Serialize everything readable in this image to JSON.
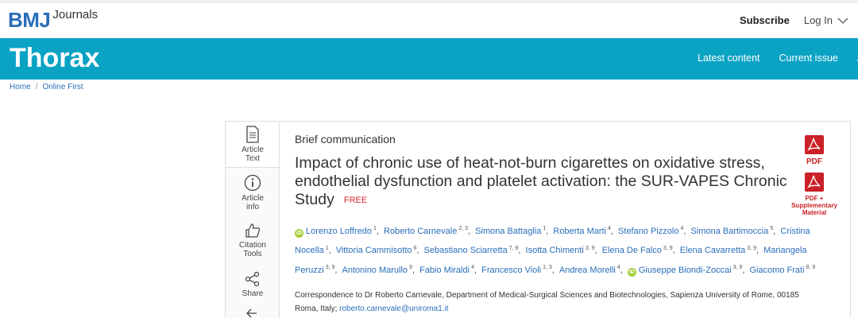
{
  "header": {
    "brand": "BMJ",
    "brand_suffix": "Journals",
    "subscribe": "Subscribe",
    "login": "Log In"
  },
  "banner": {
    "journal": "Thorax",
    "nav": [
      "Latest content",
      "Current issue",
      "A"
    ]
  },
  "breadcrumb": [
    "Home",
    "Online First"
  ],
  "tools": {
    "article_text": "Article Text",
    "article_info": "Article info",
    "citation_tools": "Citation Tools",
    "share": "Share"
  },
  "article": {
    "type": "Brief communication",
    "title": "Impact of chronic use of heat-not-burn cigarettes on oxidative stress, endothelial dysfunction and platelet activation: the SUR-VAPES Chronic Study",
    "free": "FREE",
    "authors": [
      {
        "name": "Lorenzo Loffredo",
        "sup": "1",
        "orcid": true
      },
      {
        "name": "Roberto Carnevale",
        "sup": "2, 3"
      },
      {
        "name": "Simona Battaglia",
        "sup": "1"
      },
      {
        "name": "Roberta Marti",
        "sup": "4"
      },
      {
        "name": "Stefano Pizzolo",
        "sup": "4"
      },
      {
        "name": "Simona Bartimoccia",
        "sup": "5"
      },
      {
        "name": "Cristina Nocella",
        "sup": "1"
      },
      {
        "name": "Vittoria Cammisotto",
        "sup": "6"
      },
      {
        "name": "Sebastiano Sciarretta",
        "sup": "7, 8"
      },
      {
        "name": "Isotta Chimenti",
        "sup": "3, 9"
      },
      {
        "name": "Elena De Falco",
        "sup": "3, 9"
      },
      {
        "name": "Elena Cavarretta",
        "sup": "3, 9"
      },
      {
        "name": "Mariangela Peruzzi",
        "sup": "3, 9"
      },
      {
        "name": "Antonino Marullo",
        "sup": "9"
      },
      {
        "name": "Fabio Miraldi",
        "sup": "4"
      },
      {
        "name": "Francesco Violi",
        "sup": "1, 3"
      },
      {
        "name": "Andrea Morelli",
        "sup": "4"
      },
      {
        "name": "Giuseppe Biondi-Zoccai",
        "sup": "3, 9",
        "orcid": true
      },
      {
        "name": "Giacomo Frati",
        "sup": "8, 9"
      }
    ],
    "correspondence": "Correspondence to Dr Roberto Carnevale, Department of Medical-Surgical Sciences and Biotechnologies, Sapienza University of Rome, 00185 Roma, Italy;",
    "email": "roberto.carnevale@uniroma1.it"
  },
  "downloads": {
    "pdf": "PDF",
    "pdf_supp_line1": "PDF +",
    "pdf_supp_line2": "Supplementary",
    "pdf_supp_line3": "Material"
  },
  "colors": {
    "brand_blue": "#2a6ebb",
    "banner": "#0aa3c4",
    "pdf_red": "#c92127",
    "free_red": "#d9262b",
    "orcid_green": "#a6ce39"
  }
}
